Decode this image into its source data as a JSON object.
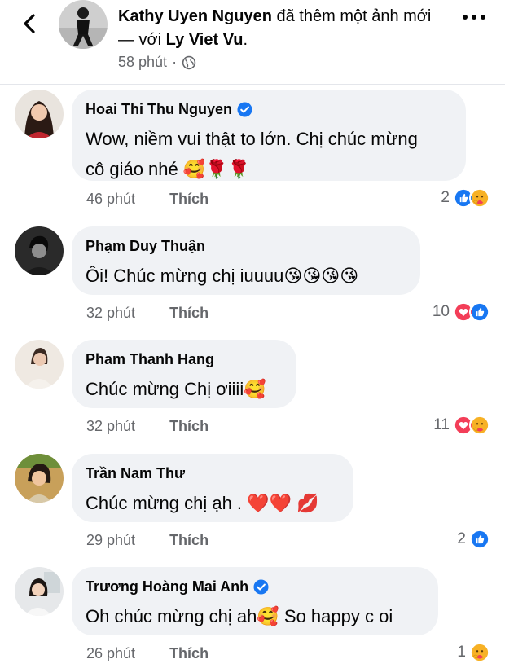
{
  "post": {
    "author": "Kathy Uyen Nguyen",
    "action_text": " đã thêm một ảnh mới — với ",
    "tagged": "Ly Viet Vu",
    "end_punct": ".",
    "time": "58 phút",
    "separator": "·",
    "privacy_icon": "globe-icon"
  },
  "like_label": "Thích",
  "comments": [
    {
      "name": "Hoai Thi Thu Nguyen",
      "verified": true,
      "text_line1": "Wow, niềm vui thật to lớn. Chị chúc mừng",
      "text_line2": "cô giáo nhé 🥰🌹🌹",
      "time": "46 phút",
      "reaction_count": "2",
      "reactions": [
        "like",
        "care"
      ]
    },
    {
      "name": "Phạm Duy Thuận",
      "verified": false,
      "text_line1": "Ôi! Chúc mừng chị iuuuu😘😘😘😘",
      "time": "32 phút",
      "reaction_count": "10",
      "reactions": [
        "love",
        "like"
      ]
    },
    {
      "name": "Pham Thanh Hang",
      "verified": false,
      "text_line1": "Chúc mừng Chị ơiiii🥰",
      "time": "32 phút",
      "reaction_count": "11",
      "reactions": [
        "love",
        "care"
      ]
    },
    {
      "name": "Trần Nam Thư",
      "verified": false,
      "text_line1": "Chúc mừng chị ạh . ❤️❤️ 💋",
      "time": "29 phút",
      "reaction_count": "2",
      "reactions": [
        "like"
      ]
    },
    {
      "name": "Trương Hoàng Mai Anh",
      "verified": true,
      "text_line1": "Oh chúc mừng chị ah🥰 So happy c oi",
      "time": "26 phút",
      "reaction_count": "1",
      "reactions": [
        "care"
      ]
    }
  ],
  "colors": {
    "like_blue": "#1877f2",
    "love_red": "#f33e58",
    "care_yellow": "#f7b125",
    "bubble_bg": "#f0f2f5",
    "meta_gray": "#65676b"
  }
}
